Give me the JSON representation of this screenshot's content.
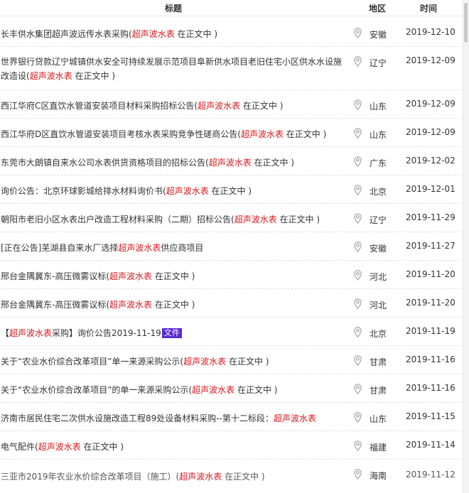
{
  "header": {
    "title": "标题",
    "region": "地区",
    "time": "时间"
  },
  "rows": [
    {
      "pre": "长丰供水集团超声波远传水表采购(",
      "kw": "超声波水表",
      "post": " 在正文中 )",
      "region": "安徽",
      "date": "2019-12-10"
    },
    {
      "pre": "世界银行贷款辽宁城镇供水安全可持续发展示范项目阜新供水项目老旧住宅小区供水水设施改造设(",
      "kw": "超声波水表",
      "post": " 在正文中 )",
      "region": "辽宁",
      "date": "2019-12-09"
    },
    {
      "pre": "西江华府C区直饮水管道安装项目材料采购招标公告(",
      "kw": "超声波水表",
      "post": " 在正文中 )",
      "region": "山东",
      "date": "2019-12-09"
    },
    {
      "pre": "西江华府D区直饮水管道安装项目考核水表采购竞争性磋商公告(",
      "kw": "超声波水表",
      "post": " 在正文中 )",
      "region": "山东",
      "date": "2019-12-09"
    },
    {
      "pre": "东莞市大朗镇自来水公司水表供货资格项目的招标公告(",
      "kw": "超声波水表",
      "post": " 在正文中 )",
      "region": "广东",
      "date": "2019-12-02"
    },
    {
      "pre": "询价公告：北京环球影城给排水材料询价书(",
      "kw": "超声波水表",
      "post": " 在正文中 )",
      "region": "北京",
      "date": "2019-12-01"
    },
    {
      "pre": "朝阳市老旧小区水表出户改造工程材料采购（二期）招标公告(",
      "kw": "超声波水表",
      "post": " 在正文中 )",
      "region": "辽宁",
      "date": "2019-11-29"
    },
    {
      "pre": "[正在公告]芜湖县自来水厂选择",
      "kw": "超声波水表",
      "post": "供应商项目",
      "region": "安徽",
      "date": "2019-11-27"
    },
    {
      "pre": "邢台金隅冀东-高压微雾议标(",
      "kw": "超声波水表",
      "post": " 在正文中 )",
      "region": "河北",
      "date": "2019-11-20"
    },
    {
      "pre": "邢台金隅冀东-高压微雾议标(",
      "kw": "超声波水表",
      "post": " 在正文中 )",
      "region": "河北",
      "date": "2019-11-20"
    },
    {
      "pre": "【",
      "kw": "超声波水表",
      "post": "采购】询价公告2019-11-19",
      "tag": "文件",
      "region": "北京",
      "date": "2019-11-19"
    },
    {
      "pre": "关于“农业水价综合改革项目”单一来源采购公示(",
      "kw": "超声波水表",
      "post": " 在正文中 )",
      "region": "甘肃",
      "date": "2019-11-16"
    },
    {
      "pre": "关于“农业水价综合改革项目”的单一来源采购公示(",
      "kw": "超声波水表",
      "post": " 在正文中 )",
      "region": "甘肃",
      "date": "2019-11-16"
    },
    {
      "pre": "济南市居民住宅二次供水设施改造工程89处设备材料采购--第十二标段：",
      "kw": "超声波水表",
      "post": "",
      "region": "山东",
      "date": "2019-11-15"
    },
    {
      "pre": "电气配件(",
      "kw": "超声波水表",
      "post": " 在正文中 )",
      "region": "福建",
      "date": "2019-11-14"
    },
    {
      "pre": "三亚市2019年农业水价综合改革项目（施工）(",
      "kw": "超声波水表",
      "post": " 在正文中 )",
      "region": "海南",
      "date": "2019-11-12"
    }
  ],
  "icons": {
    "location": "location-pin-icon"
  },
  "colors": {
    "keyword": "#d7191c",
    "file_tag": "#5b2bd5",
    "text": "#333333"
  }
}
